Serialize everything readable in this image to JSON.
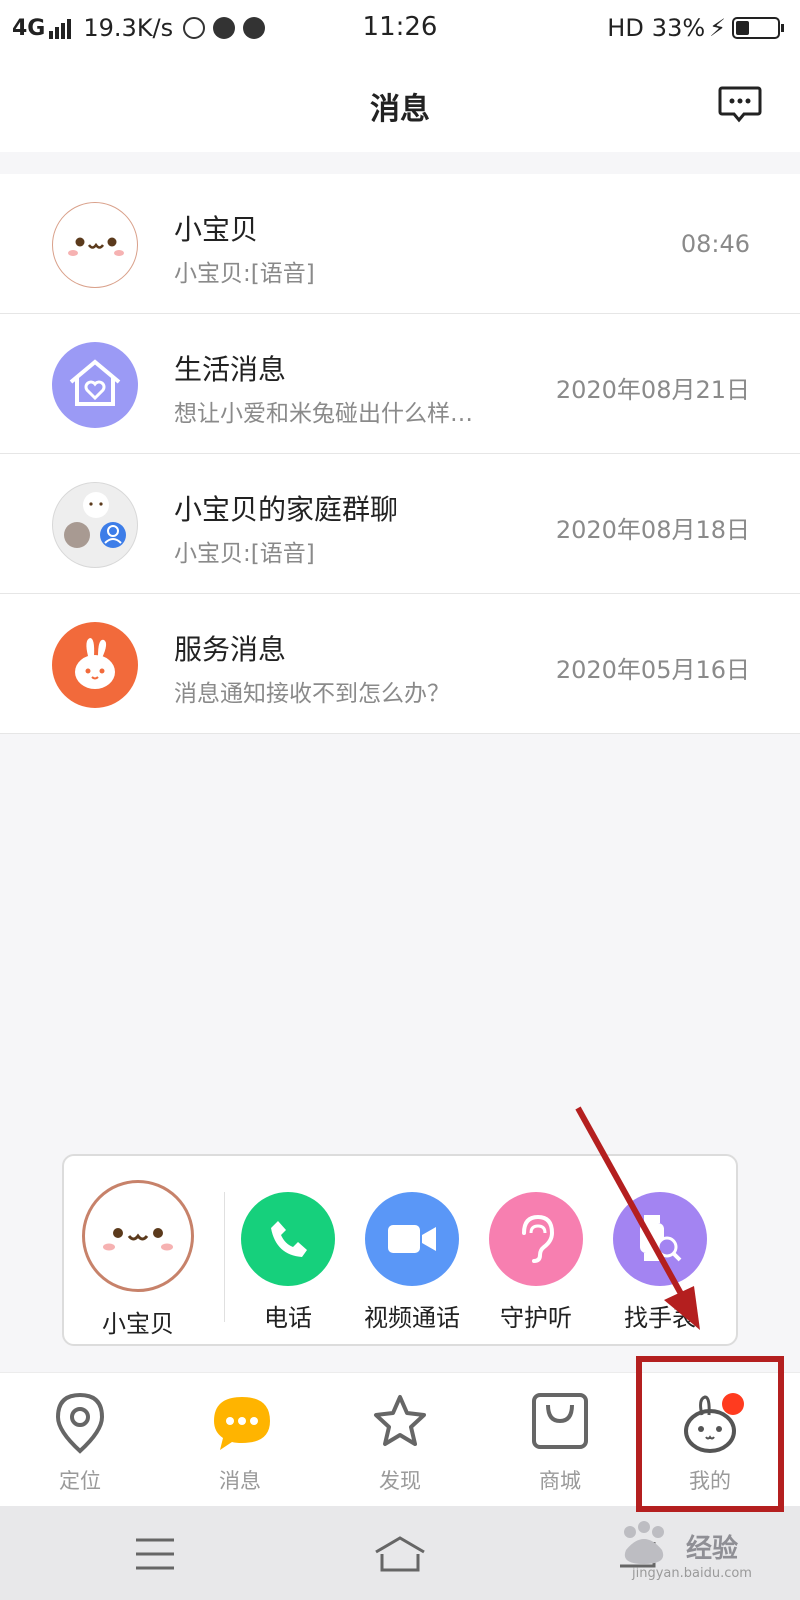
{
  "status_bar": {
    "network": "4G",
    "speed": "19.3K/s",
    "time": "11:26",
    "hd": "HD",
    "battery_percent_text": "33%",
    "battery_level": 0.33
  },
  "header": {
    "title": "消息",
    "chat_icon": "chat-bubble-icon"
  },
  "messages": [
    {
      "name": "小宝贝",
      "preview": "小宝贝:[语音]",
      "time": "08:46",
      "avatar_icon": "cute-face-avatar"
    },
    {
      "name": "生活消息",
      "preview": "想让小爱和米兔碰出什么样…",
      "time": "2020年08月21日",
      "avatar_icon": "house-heart-avatar"
    },
    {
      "name": "小宝贝的家庭群聊",
      "preview": "小宝贝:[语音]",
      "time": "2020年08月18日",
      "avatar_icon": "group-avatar"
    },
    {
      "name": "服务消息",
      "preview": "消息通知接收不到怎么办？",
      "time": "2020年05月16日",
      "avatar_icon": "rabbit-avatar"
    }
  ],
  "quick_bar": {
    "child_name": "小宝贝",
    "actions": [
      {
        "label": "电话",
        "icon": "phone-icon",
        "color": "#16d07c"
      },
      {
        "label": "视频通话",
        "icon": "video-camera-icon",
        "color": "#5a97f7"
      },
      {
        "label": "守护听",
        "icon": "ear-icon",
        "color": "#f77fb0"
      },
      {
        "label": "找手表",
        "icon": "watch-search-icon",
        "color": "#a384f2"
      }
    ]
  },
  "tabbar": {
    "tabs": [
      {
        "label": "定位",
        "icon": "location-pin-icon"
      },
      {
        "label": "消息",
        "icon": "message-bubble-icon"
      },
      {
        "label": "发现",
        "icon": "star-icon"
      },
      {
        "label": "商城",
        "icon": "shopping-bag-icon"
      },
      {
        "label": "我的",
        "icon": "profile-rabbit-icon"
      }
    ],
    "active_color": "#ffb400"
  },
  "watermark": {
    "text": "经验",
    "sub": "jingyan.baidu.com"
  },
  "colors": {
    "annotation": "#b41f1f"
  }
}
